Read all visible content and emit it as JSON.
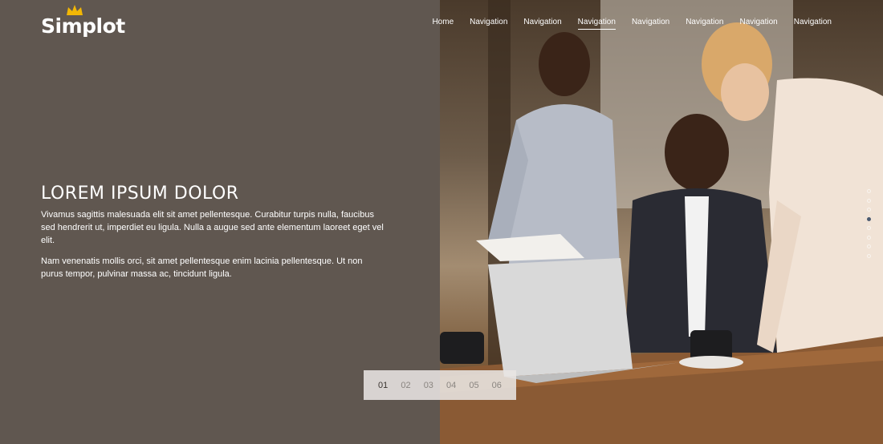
{
  "brand": {
    "name": "Simplot",
    "crown_color": "#f2b705"
  },
  "nav": {
    "items": [
      {
        "label": "Home",
        "active": false
      },
      {
        "label": "Navigation",
        "active": false
      },
      {
        "label": "Navigation",
        "active": false
      },
      {
        "label": "Navigation",
        "active": true
      },
      {
        "label": "Navigation",
        "active": false
      },
      {
        "label": "Navigation",
        "active": false
      },
      {
        "label": "Navigation",
        "active": false
      },
      {
        "label": "Navigation",
        "active": false
      }
    ]
  },
  "hero": {
    "title": "LOREM IPSUM DOLOR",
    "paragraph1": "Vivamus sagittis malesuada elit sit amet pellentesque. Curabitur turpis nulla, faucibus sed hendrerit ut, imperdiet eu ligula. Nulla a augue sed ante elementum laoreet eget vel elit.",
    "paragraph2": "Nam venenatis mollis orci, sit amet pellentesque enim lacinia pellentesque. Ut non purus tempor, pulvinar massa ac, tincidunt ligula."
  },
  "pager": {
    "items": [
      "01",
      "02",
      "03",
      "04",
      "05",
      "06"
    ],
    "active_index": 0
  },
  "side_dots": {
    "count": 8,
    "active_index": 3
  },
  "colors": {
    "panel_bg": "#605750",
    "text": "#ffffff",
    "pager_bg": "#e8e5e2"
  },
  "photo": {
    "icon": "office-meeting-photo"
  }
}
